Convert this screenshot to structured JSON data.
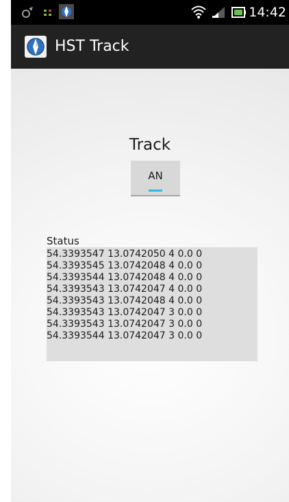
{
  "status_bar": {
    "time": "14:42",
    "icons_left": [
      "gps-icon",
      "signal-strength-icon",
      "app-notification-icon"
    ],
    "icons_right": [
      "wifi-icon",
      "cellular-signal-icon",
      "battery-icon"
    ]
  },
  "action_bar": {
    "title": "HST Track",
    "icon": "compass-icon"
  },
  "main": {
    "track_label": "Track",
    "toggle_label": "AN",
    "status_label": "Status",
    "status_lines": [
      "54.3393547 13.0742050 4 0.0 0",
      "54.3393545 13.0742048 4 0.0 0",
      "54.3393544 13.0742048 4 0.0 0",
      "54.3393543 13.0742047 4 0.0 0",
      "54.3393543 13.0742048 4 0.0 0",
      "54.3393543 13.0742047 3 0.0 0",
      "54.3393543 13.0742047 3 0.0 0",
      "54.3393544 13.0742047 3 0.0 0"
    ]
  },
  "colors": {
    "accent": "#33b5e5",
    "action_bar": "#222222",
    "status_bar": "#000000",
    "status_box": "#dedede"
  }
}
